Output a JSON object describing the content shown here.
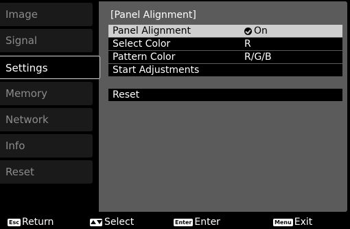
{
  "sidebar": {
    "items": [
      {
        "label": "Image"
      },
      {
        "label": "Signal"
      },
      {
        "label": "Settings"
      },
      {
        "label": "Memory"
      },
      {
        "label": "Network"
      },
      {
        "label": "Info"
      },
      {
        "label": "Reset"
      }
    ],
    "active_index": 2
  },
  "panel": {
    "title": "[Panel Alignment]",
    "rows": [
      {
        "label": "Panel Alignment",
        "value": "On",
        "icon": "check-icon",
        "selected": true
      },
      {
        "label": "Select Color",
        "value": "R"
      },
      {
        "label": "Pattern Color",
        "value": "R/G/B"
      },
      {
        "label": "Start Adjustments",
        "value": ""
      },
      {
        "label": "Reset",
        "value": ""
      }
    ]
  },
  "footer": {
    "return": {
      "key": "Esc",
      "label": "Return"
    },
    "select": {
      "key_icon": "up-down-arrows-icon",
      "label": "Select"
    },
    "enter": {
      "key": "Enter",
      "label": "Enter"
    },
    "exit": {
      "key": "Menu",
      "label": "Exit"
    }
  },
  "colors": {
    "background": "#000000",
    "panel": "#5b5b5b",
    "selected_row": "#cfcfcf",
    "inactive_tab": "#1a1a1a",
    "inactive_text": "#8c8c8c"
  }
}
